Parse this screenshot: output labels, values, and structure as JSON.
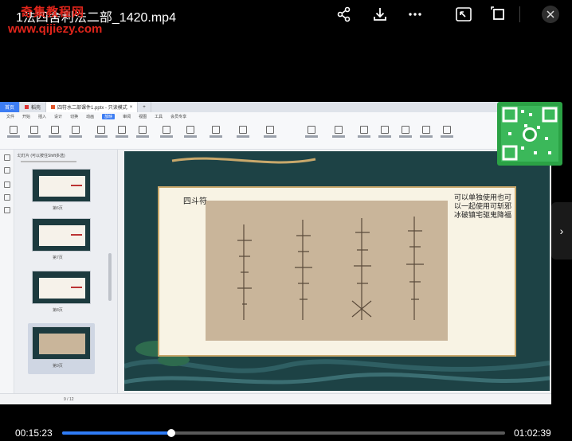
{
  "player": {
    "title": "1法四舍利法二部_1420.mp4",
    "watermark_line1": "奇集教程网",
    "watermark_line2": "www.qijiezy.com",
    "current_time": "00:15:23",
    "total_time": "01:02:39",
    "progress_fraction": 0.247,
    "icons": [
      "share-icon",
      "download-icon",
      "more-icon",
      "picture-in-picture-icon",
      "fullscreen-icon",
      "close-icon"
    ]
  },
  "wps": {
    "tabs": [
      {
        "label": "首页"
      },
      {
        "label": "稻壳"
      },
      {
        "label": "四符水二部课件1.pptx - 只读模式"
      }
    ],
    "menu": [
      "文件",
      "开始",
      "插入",
      "设计",
      "切换",
      "动画",
      "放映",
      "审阅",
      "视图",
      "工具",
      "会员专享"
    ],
    "side_header": "幻灯片 (可以按住Shift多选)",
    "thumb_labels": [
      "第6页",
      "第7页",
      "第8页",
      "第9页"
    ],
    "status_page": "9 / 12"
  },
  "slide": {
    "label": "四斗符",
    "note": "可以单独使用也可以一起使用可斩邪冰破镇宅驱鬼降福"
  },
  "colors": {
    "progress_accent": "#2f7cf6",
    "watermark_red": "#e0251b",
    "slide_bg": "#1d4245",
    "wechat_green": "#2ba245"
  }
}
